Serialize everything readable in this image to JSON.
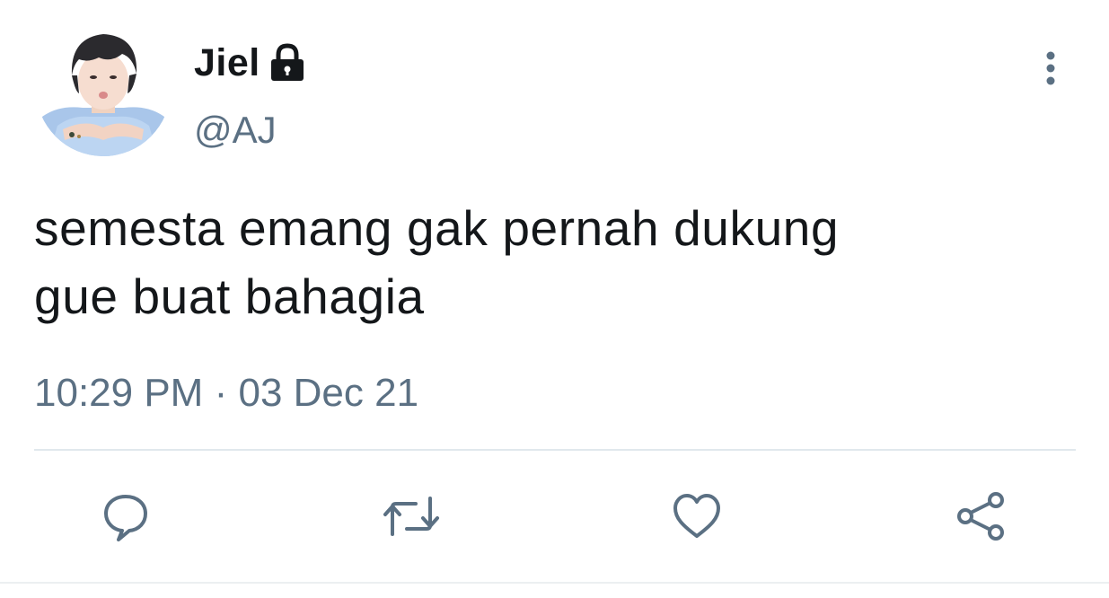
{
  "user": {
    "display_name": "Jiel",
    "handle": "@AJ",
    "protected_icon": "lock-icon",
    "avatar": "profile-photo"
  },
  "tweet": {
    "text_line1": "semesta emang gak pernah dukung",
    "text_line2": "gue buat bahagia",
    "time": "10:29 PM",
    "separator": "·",
    "date": "03 Dec 21"
  },
  "menu": {
    "icon": "more-vertical-icon"
  },
  "actions": [
    {
      "name": "reply",
      "icon": "comment-icon"
    },
    {
      "name": "retweet",
      "icon": "retweet-icon"
    },
    {
      "name": "like",
      "icon": "heart-icon"
    },
    {
      "name": "share",
      "icon": "share-icon"
    }
  ],
  "colors": {
    "text_primary": "#14171a",
    "text_secondary": "#5b7083",
    "divider": "#e1e8ed",
    "icon": "#5b7083"
  }
}
